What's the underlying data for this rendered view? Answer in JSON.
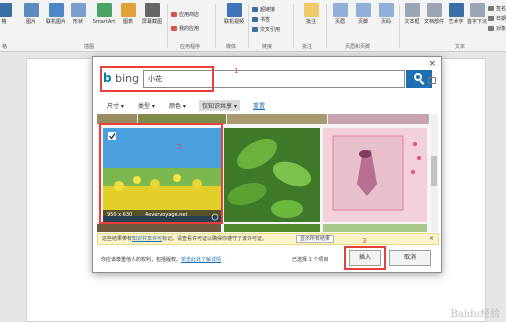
{
  "ribbon": {
    "buttons": [
      {
        "label": "格",
        "color": "#3b6ea5"
      },
      {
        "label": "图片",
        "color": "#5d8bbf"
      },
      {
        "label": "联机图片",
        "color": "#4f86c6"
      },
      {
        "label": "形状",
        "color": "#7a9fcc"
      },
      {
        "label": "SmartArt",
        "color": "#4aa564"
      },
      {
        "label": "图表",
        "color": "#e0a23a"
      },
      {
        "label": "屏幕截图",
        "color": "#666666"
      },
      {
        "label": "联机视频",
        "color": "#3f74b8"
      },
      {
        "label": "批注",
        "color": "#f0c96a"
      },
      {
        "label": "页眉",
        "color": "#8fb0d8"
      },
      {
        "label": "页脚",
        "color": "#8fb0d8"
      },
      {
        "label": "页码",
        "color": "#8fb0d8"
      },
      {
        "label": "文本框",
        "color": "#9aa6b4"
      },
      {
        "label": "文档部件",
        "color": "#9aa6b4"
      },
      {
        "label": "艺术字",
        "color": "#3b6ea5"
      },
      {
        "label": "首字下沉",
        "color": "#9aa6b4"
      }
    ],
    "small_items": [
      {
        "label": "应用商店",
        "color": "#d9534f"
      },
      {
        "label": "我的应用",
        "color": "#d9534f"
      },
      {
        "label": "超链接",
        "color": "#3b6ea5"
      },
      {
        "label": "书签",
        "color": "#3b6ea5"
      },
      {
        "label": "交叉引用",
        "color": "#3b6ea5"
      },
      {
        "label": "签名",
        "color": "#777777"
      },
      {
        "label": "日期",
        "color": "#777777"
      },
      {
        "label": "对象",
        "color": "#777777"
      }
    ],
    "groups": [
      "格",
      "插图",
      "应用程序",
      "媒体",
      "链接",
      "批注",
      "页眉和页脚",
      "文本"
    ]
  },
  "dialog": {
    "brand": "bing",
    "search": {
      "value": "小花"
    },
    "filters": [
      "尺寸",
      "类型",
      "颜色",
      "仅知识共享",
      "重置"
    ],
    "selected_tile": {
      "size": "950 x 630",
      "source": "4evervoyage.net",
      "checked": true
    },
    "notice": {
      "text_a": "这些结果带有",
      "link": "知识共享许可",
      "text_b": "标记。请查看许可证以确保你遵守了该许可证。",
      "button": "显示所有结果"
    },
    "footer": {
      "text_a": "你应该尊重他人的权利，包括版权。",
      "link": "单击此处了解详情"
    },
    "selected_count": "已选择 1 个项目",
    "insert_label": "插入",
    "cancel_label": "取消",
    "close_label": "×"
  },
  "annotations": [
    "1",
    "2",
    "3"
  ],
  "watermark": "Baidu经验",
  "colors": {
    "accent": "#1f6fb3",
    "annotation": "#e8403a",
    "bing": "#00809d"
  }
}
